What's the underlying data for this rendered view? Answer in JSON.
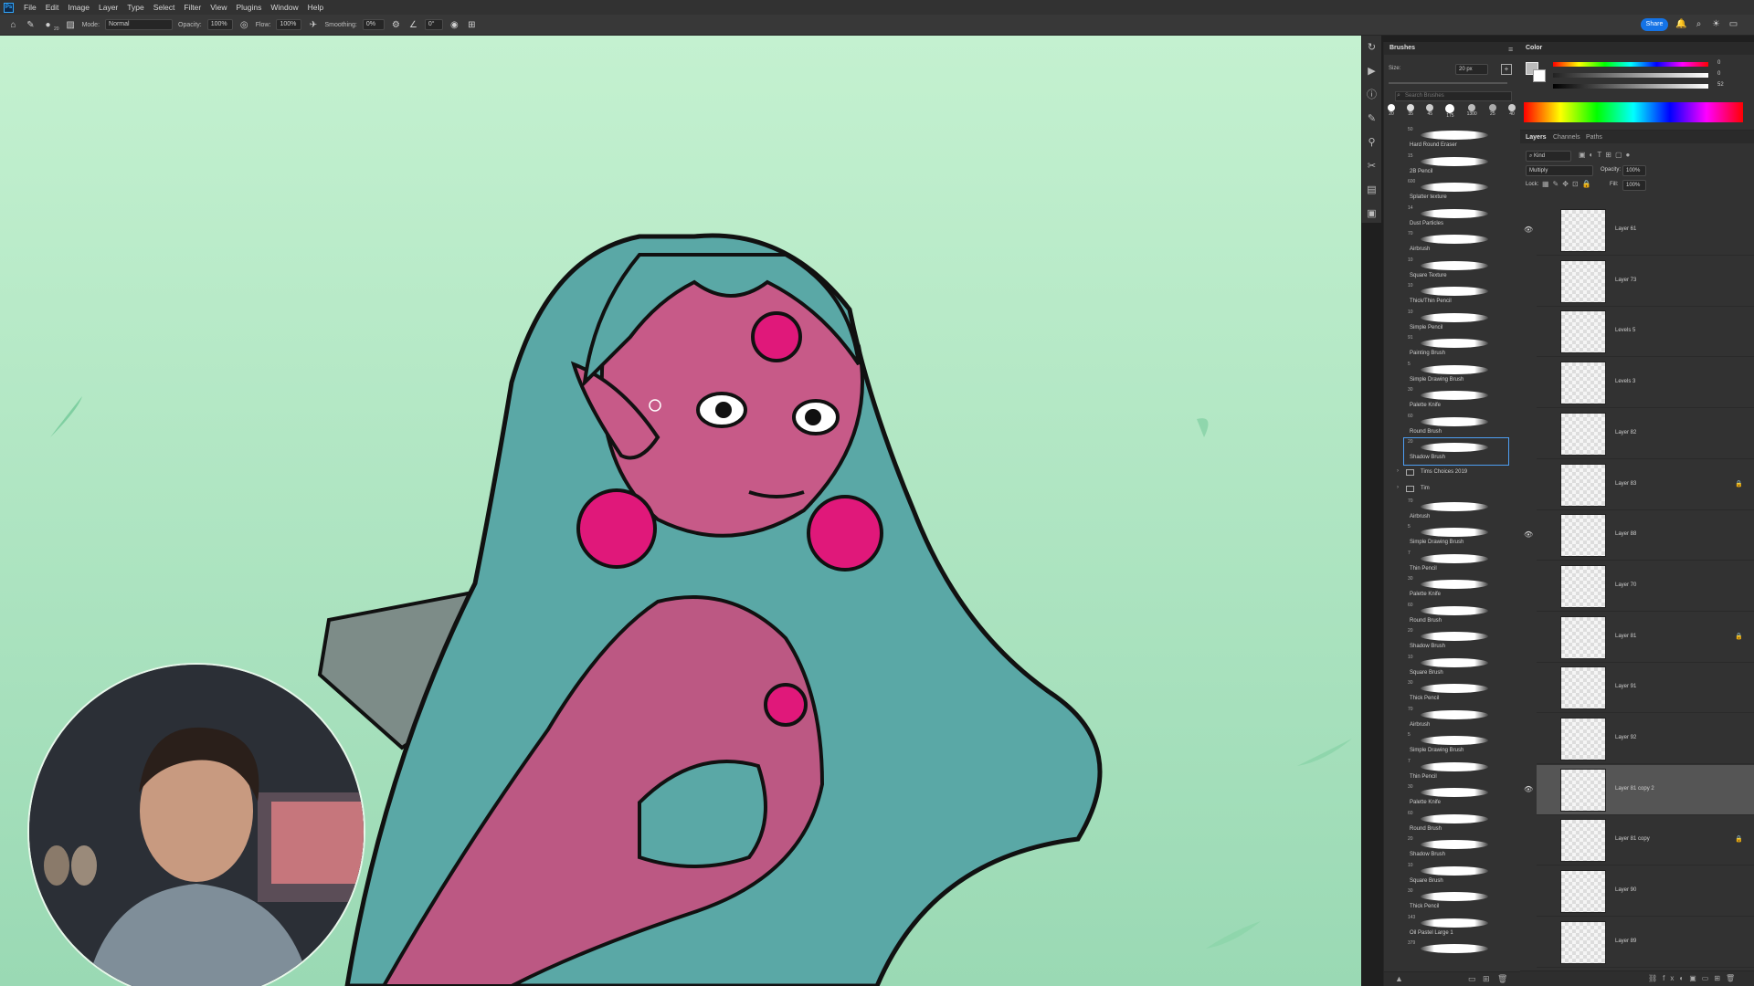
{
  "menu": [
    "File",
    "Edit",
    "Image",
    "Layer",
    "Type",
    "Select",
    "Filter",
    "View",
    "Plugins",
    "Window",
    "Help"
  ],
  "options": {
    "mode_label": "Mode:",
    "mode_value": "Normal",
    "opacity_label": "Opacity:",
    "opacity_value": "100%",
    "flow_label": "Flow:",
    "flow_value": "100%",
    "smoothing_label": "Smoothing:",
    "smoothing_value": "0%",
    "angle_value": "0°",
    "brush_size": "20",
    "share_label": "Share"
  },
  "brushes_panel": {
    "title": "Brushes",
    "size_label": "Size:",
    "size_value": "20 px",
    "search_placeholder": "Search Brushes",
    "preset_sizes": [
      "20",
      "35",
      "45",
      "175",
      "1300",
      "25",
      "40"
    ],
    "items": [
      {
        "num": "50",
        "name": "Hard Round Eraser"
      },
      {
        "num": "15",
        "name": "2B Pencil"
      },
      {
        "num": "600",
        "name": "Splatter texture"
      },
      {
        "num": "14",
        "name": "Dust Particles"
      },
      {
        "num": "70",
        "name": "Airbrush"
      },
      {
        "num": "10",
        "name": "Square Texture"
      },
      {
        "num": "10",
        "name": "Thick/Thin Pencil"
      },
      {
        "num": "10",
        "name": "Simple Pencil"
      },
      {
        "num": "91",
        "name": "Painting Brush"
      },
      {
        "num": "5",
        "name": "Simple Drawing Brush"
      },
      {
        "num": "30",
        "name": "Palette Knife"
      },
      {
        "num": "60",
        "name": "Round Brush"
      },
      {
        "num": "20",
        "name": "Shadow Brush",
        "selected": true
      }
    ],
    "group1": "Tims Choices 2019",
    "group2": "Tim",
    "items2": [
      {
        "num": "70",
        "name": "Airbrush"
      },
      {
        "num": "5",
        "name": "Simple Drawing Brush"
      },
      {
        "num": "7",
        "name": "Thin Pencil"
      },
      {
        "num": "30",
        "name": "Palette Knife"
      },
      {
        "num": "60",
        "name": "Round Brush"
      },
      {
        "num": "20",
        "name": "Shadow Brush"
      },
      {
        "num": "10",
        "name": "Square Brush"
      },
      {
        "num": "30",
        "name": "Thick Pencil"
      },
      {
        "num": "70",
        "name": "Airbrush"
      },
      {
        "num": "5",
        "name": "Simple Drawing Brush"
      },
      {
        "num": "7",
        "name": "Thin Pencil"
      },
      {
        "num": "30",
        "name": "Palette Knife"
      },
      {
        "num": "60",
        "name": "Round Brush"
      },
      {
        "num": "20",
        "name": "Shadow Brush"
      },
      {
        "num": "10",
        "name": "Square Brush"
      },
      {
        "num": "30",
        "name": "Thick Pencil"
      },
      {
        "num": "143",
        "name": "Oil Pastel Large 1"
      },
      {
        "num": "379",
        "name": ""
      }
    ]
  },
  "color_panel": {
    "title": "Color",
    "r": "0",
    "g": "0",
    "b": "52"
  },
  "layers_panel": {
    "tabs": [
      "Layers",
      "Channels",
      "Paths"
    ],
    "kind_label": "Kind",
    "blend_mode": "Multiply",
    "opacity_label": "Opacity:",
    "opacity_value": "100%",
    "lock_label": "Lock:",
    "fill_label": "Fill:",
    "fill_value": "100%",
    "layers": [
      {
        "name": "Layer 61",
        "eye": true
      },
      {
        "name": "Layer 73"
      },
      {
        "name": "Levels 5"
      },
      {
        "name": "Levels 3"
      },
      {
        "name": "Layer 82"
      },
      {
        "name": "Layer 83",
        "locked": true
      },
      {
        "name": "Layer 88",
        "eye": true
      },
      {
        "name": "Layer 70"
      },
      {
        "name": "Layer 81",
        "locked": true
      },
      {
        "name": "Layer 91"
      },
      {
        "name": "Layer 92"
      },
      {
        "name": "Layer 81 copy 2",
        "eye": true,
        "selected": true
      },
      {
        "name": "Layer 81 copy",
        "locked": true
      },
      {
        "name": "Layer 90"
      },
      {
        "name": "Layer 89"
      }
    ]
  }
}
